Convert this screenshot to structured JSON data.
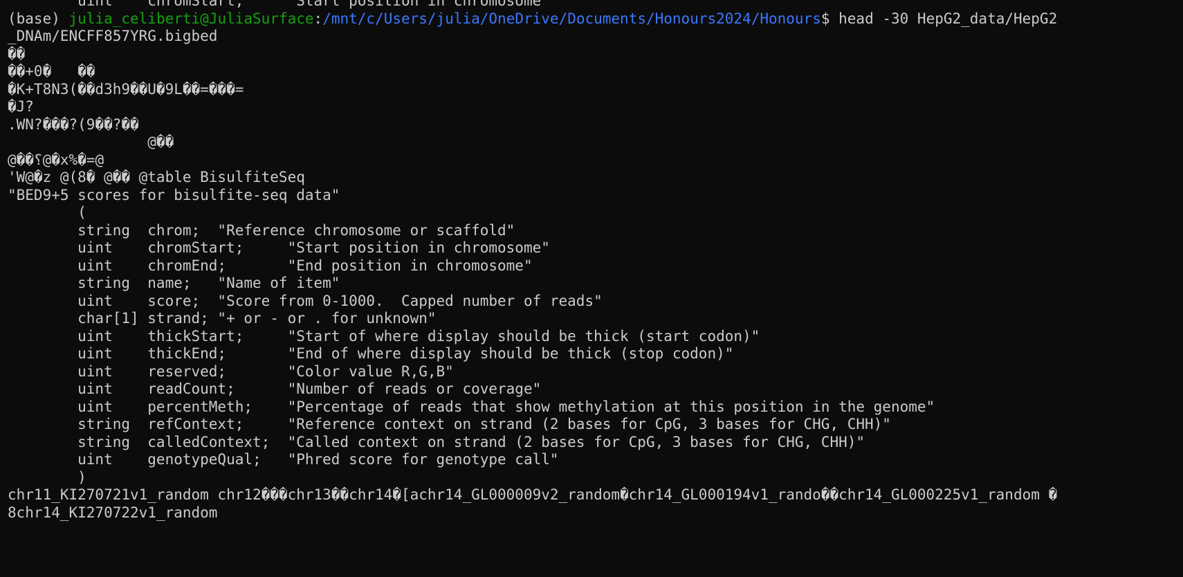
{
  "terminal": {
    "prompt": {
      "env": "(base) ",
      "user_host": "julia_celiberti@JuliaSurface",
      "colon": ":",
      "cwd": "/mnt/c/Users/julia/OneDrive/Documents/Honours2024/Honours",
      "symbol": "$ ",
      "command": "head -30 HepG2_data/HepG2"
    },
    "lines": [
      "        uint    chromStart;     \"Start position in chromosome\"",
      "__PROMPT__",
      "_DNAm/ENCFF857YRG.bigbed",
      "��",
      "��+0�   ��",
      "�K+T8N3(��d3h9��U�9L��=���=",
      "�J?",
      ".WN?���?(9��?��",
      "                @��",
      "@��؟@�x%�=@",
      "'W@�z @(8� @�� @table BisulfiteSeq",
      "\"BED9+5 scores for bisulfite-seq data\"",
      "        (",
      "        string  chrom;  \"Reference chromosome or scaffold\"",
      "        uint    chromStart;     \"Start position in chromosome\"",
      "        uint    chromEnd;       \"End position in chromosome\"",
      "        string  name;   \"Name of item\"",
      "        uint    score;  \"Score from 0-1000.  Capped number of reads\"",
      "        char[1] strand; \"+ or - or . for unknown\"",
      "        uint    thickStart;     \"Start of where display should be thick (start codon)\"",
      "        uint    thickEnd;       \"End of where display should be thick (stop codon)\"",
      "        uint    reserved;       \"Color value R,G,B\"",
      "        uint    readCount;      \"Number of reads or coverage\"",
      "        uint    percentMeth;    \"Percentage of reads that show methylation at this position in the genome\"",
      "        string  refContext;     \"Reference context on strand (2 bases for CpG, 3 bases for CHG, CHH)\"",
      "        string  calledContext;  \"Called context on strand (2 bases for CpG, 3 bases for CHG, CHH)\"",
      "        uint    genotypeQual;   \"Phred score for genotype call\"",
      "        )",
      "chr11_KI270721v1_random chr12���chr13��chr14�[achr14_GL000009v2_random�chr14_GL000194v1_rando��chr14_GL000225v1_random �",
      "8chr14_KI270722v1_random"
    ]
  },
  "colors": {
    "background": "#0c0c0c",
    "foreground": "#cccccc",
    "user_host": "#13a10e",
    "path": "#3b78ff"
  }
}
